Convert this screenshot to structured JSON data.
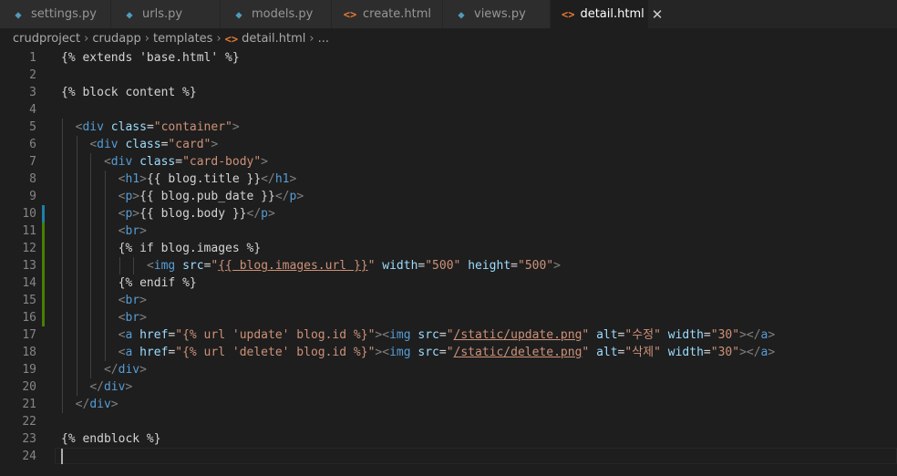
{
  "tabs": [
    {
      "label": "settings.py",
      "type": "py",
      "active": false
    },
    {
      "label": "urls.py",
      "type": "py",
      "active": false
    },
    {
      "label": "models.py",
      "type": "py",
      "active": false
    },
    {
      "label": "create.html",
      "type": "html",
      "active": false
    },
    {
      "label": "views.py",
      "type": "py",
      "active": false
    },
    {
      "label": "detail.html",
      "type": "html",
      "active": true
    }
  ],
  "breadcrumb": {
    "segments": [
      "crudproject",
      "crudapp",
      "templates",
      "detail.html",
      "..."
    ]
  },
  "editor": {
    "lines": [
      {
        "n": "1",
        "gutter": "",
        "indent": 0,
        "parts": [
          [
            "t",
            "{% extends 'base.html' %}"
          ]
        ]
      },
      {
        "n": "2",
        "gutter": "",
        "indent": 0,
        "parts": []
      },
      {
        "n": "3",
        "gutter": "",
        "indent": 0,
        "parts": [
          [
            "t",
            "{% block content %}"
          ]
        ]
      },
      {
        "n": "4",
        "gutter": "",
        "indent": 0,
        "parts": []
      },
      {
        "n": "5",
        "gutter": "",
        "indent": 1,
        "parts": [
          [
            "p",
            "<"
          ],
          [
            "g",
            "div"
          ],
          [
            "t",
            " "
          ],
          [
            "a",
            "class"
          ],
          [
            "t",
            "="
          ],
          [
            "s",
            "\"container\""
          ],
          [
            "p",
            ">"
          ]
        ]
      },
      {
        "n": "6",
        "gutter": "",
        "indent": 2,
        "parts": [
          [
            "p",
            "<"
          ],
          [
            "g",
            "div"
          ],
          [
            "t",
            " "
          ],
          [
            "a",
            "class"
          ],
          [
            "t",
            "="
          ],
          [
            "s",
            "\"card\""
          ],
          [
            "p",
            ">"
          ]
        ]
      },
      {
        "n": "7",
        "gutter": "",
        "indent": 3,
        "parts": [
          [
            "p",
            "<"
          ],
          [
            "g",
            "div"
          ],
          [
            "t",
            " "
          ],
          [
            "a",
            "class"
          ],
          [
            "t",
            "="
          ],
          [
            "s",
            "\"card-body\""
          ],
          [
            "p",
            ">"
          ]
        ]
      },
      {
        "n": "8",
        "gutter": "",
        "indent": 4,
        "parts": [
          [
            "p",
            "<"
          ],
          [
            "g",
            "h1"
          ],
          [
            "p",
            ">"
          ],
          [
            "t",
            "{{ blog.title }}"
          ],
          [
            "p",
            "</"
          ],
          [
            "g",
            "h1"
          ],
          [
            "p",
            ">"
          ]
        ]
      },
      {
        "n": "9",
        "gutter": "",
        "indent": 4,
        "parts": [
          [
            "p",
            "<"
          ],
          [
            "g",
            "p"
          ],
          [
            "p",
            ">"
          ],
          [
            "t",
            "{{ blog.pub_date }}"
          ],
          [
            "p",
            "</"
          ],
          [
            "g",
            "p"
          ],
          [
            "p",
            ">"
          ]
        ]
      },
      {
        "n": "10",
        "gutter": "blue",
        "indent": 4,
        "parts": [
          [
            "p",
            "<"
          ],
          [
            "g",
            "p"
          ],
          [
            "p",
            ">"
          ],
          [
            "t",
            "{{ blog.body }}"
          ],
          [
            "p",
            "</"
          ],
          [
            "g",
            "p"
          ],
          [
            "p",
            ">"
          ]
        ]
      },
      {
        "n": "11",
        "gutter": "green",
        "indent": 4,
        "parts": [
          [
            "p",
            "<"
          ],
          [
            "g",
            "br"
          ],
          [
            "p",
            ">"
          ]
        ]
      },
      {
        "n": "12",
        "gutter": "green",
        "indent": 4,
        "parts": [
          [
            "t",
            "{% if blog.images %}"
          ]
        ]
      },
      {
        "n": "13",
        "gutter": "green",
        "indent": 6,
        "parts": [
          [
            "p",
            "<"
          ],
          [
            "g",
            "img"
          ],
          [
            "t",
            " "
          ],
          [
            "a",
            "src"
          ],
          [
            "t",
            "="
          ],
          [
            "s",
            "\""
          ],
          [
            "u",
            "{{ blog.images.url }}"
          ],
          [
            "s",
            "\""
          ],
          [
            "t",
            " "
          ],
          [
            "a",
            "width"
          ],
          [
            "t",
            "="
          ],
          [
            "s",
            "\"500\""
          ],
          [
            "t",
            " "
          ],
          [
            "a",
            "height"
          ],
          [
            "t",
            "="
          ],
          [
            "s",
            "\"500\""
          ],
          [
            "p",
            ">"
          ]
        ]
      },
      {
        "n": "14",
        "gutter": "green",
        "indent": 4,
        "parts": [
          [
            "t",
            "{% endif %}"
          ]
        ]
      },
      {
        "n": "15",
        "gutter": "green",
        "indent": 4,
        "parts": [
          [
            "p",
            "<"
          ],
          [
            "g",
            "br"
          ],
          [
            "p",
            ">"
          ]
        ]
      },
      {
        "n": "16",
        "gutter": "green",
        "indent": 4,
        "parts": [
          [
            "p",
            "<"
          ],
          [
            "g",
            "br"
          ],
          [
            "p",
            ">"
          ]
        ]
      },
      {
        "n": "17",
        "gutter": "",
        "indent": 4,
        "parts": [
          [
            "p",
            "<"
          ],
          [
            "g",
            "a"
          ],
          [
            "t",
            " "
          ],
          [
            "a",
            "href"
          ],
          [
            "t",
            "="
          ],
          [
            "s",
            "\"{% url 'update' blog.id %}\""
          ],
          [
            "p",
            ">"
          ],
          [
            "p",
            "<"
          ],
          [
            "g",
            "img"
          ],
          [
            "t",
            " "
          ],
          [
            "a",
            "src"
          ],
          [
            "t",
            "="
          ],
          [
            "s",
            "\""
          ],
          [
            "u",
            "/static/update.png"
          ],
          [
            "s",
            "\""
          ],
          [
            "t",
            " "
          ],
          [
            "a",
            "alt"
          ],
          [
            "t",
            "="
          ],
          [
            "s",
            "\"수정\""
          ],
          [
            "t",
            " "
          ],
          [
            "a",
            "width"
          ],
          [
            "t",
            "="
          ],
          [
            "s",
            "\"30\""
          ],
          [
            "p",
            ">"
          ],
          [
            "p",
            "</"
          ],
          [
            "g",
            "a"
          ],
          [
            "p",
            ">"
          ]
        ]
      },
      {
        "n": "18",
        "gutter": "",
        "indent": 4,
        "parts": [
          [
            "p",
            "<"
          ],
          [
            "g",
            "a"
          ],
          [
            "t",
            " "
          ],
          [
            "a",
            "href"
          ],
          [
            "t",
            "="
          ],
          [
            "s",
            "\"{% url 'delete' blog.id %}\""
          ],
          [
            "p",
            ">"
          ],
          [
            "p",
            "<"
          ],
          [
            "g",
            "img"
          ],
          [
            "t",
            " "
          ],
          [
            "a",
            "src"
          ],
          [
            "t",
            "="
          ],
          [
            "s",
            "\""
          ],
          [
            "u",
            "/static/delete.png"
          ],
          [
            "s",
            "\""
          ],
          [
            "t",
            " "
          ],
          [
            "a",
            "alt"
          ],
          [
            "t",
            "="
          ],
          [
            "s",
            "\"삭제\""
          ],
          [
            "t",
            " "
          ],
          [
            "a",
            "width"
          ],
          [
            "t",
            "="
          ],
          [
            "s",
            "\"30\""
          ],
          [
            "p",
            ">"
          ],
          [
            "p",
            "</"
          ],
          [
            "g",
            "a"
          ],
          [
            "p",
            ">"
          ]
        ]
      },
      {
        "n": "19",
        "gutter": "",
        "indent": 3,
        "parts": [
          [
            "p",
            "</"
          ],
          [
            "g",
            "div"
          ],
          [
            "p",
            ">"
          ]
        ]
      },
      {
        "n": "20",
        "gutter": "",
        "indent": 2,
        "parts": [
          [
            "p",
            "</"
          ],
          [
            "g",
            "div"
          ],
          [
            "p",
            ">"
          ]
        ]
      },
      {
        "n": "21",
        "gutter": "",
        "indent": 1,
        "parts": [
          [
            "p",
            "</"
          ],
          [
            "g",
            "div"
          ],
          [
            "p",
            ">"
          ]
        ]
      },
      {
        "n": "22",
        "gutter": "",
        "indent": 0,
        "parts": []
      },
      {
        "n": "23",
        "gutter": "",
        "indent": 0,
        "parts": [
          [
            "t",
            "{% endblock %}"
          ]
        ]
      },
      {
        "n": "24",
        "gutter": "",
        "indent": 0,
        "parts": [],
        "current": true
      }
    ]
  }
}
